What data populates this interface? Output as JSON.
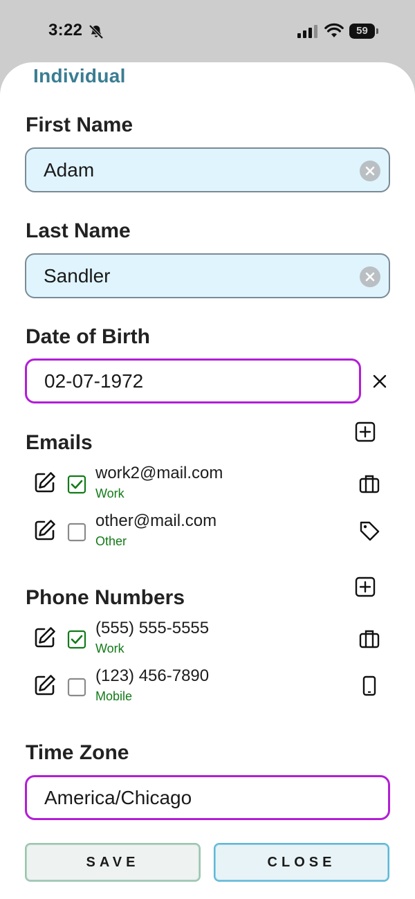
{
  "status_bar": {
    "time": "3:22",
    "battery": "59"
  },
  "sheet": {
    "title": "Individual"
  },
  "form": {
    "first_name": {
      "label": "First Name",
      "value": "Adam"
    },
    "last_name": {
      "label": "Last Name",
      "value": "Sandler"
    },
    "dob": {
      "label": "Date of Birth",
      "value": "02-07-1972"
    },
    "time_zone": {
      "label": "Time Zone",
      "value": "America/Chicago"
    }
  },
  "emails": {
    "label": "Emails",
    "items": [
      {
        "address": "work2@mail.com",
        "type": "Work",
        "checked": true,
        "icon": "briefcase-icon"
      },
      {
        "address": "other@mail.com",
        "type": "Other",
        "checked": false,
        "icon": "tag-icon"
      }
    ]
  },
  "phones": {
    "label": "Phone Numbers",
    "items": [
      {
        "number": "(555) 555-5555",
        "type": "Work",
        "checked": true,
        "icon": "briefcase-icon"
      },
      {
        "number": "(123) 456-7890",
        "type": "Mobile",
        "checked": false,
        "icon": "mobile-phone-icon"
      }
    ]
  },
  "buttons": {
    "save": "SAVE",
    "close": "CLOSE"
  },
  "colors": {
    "accent_purple": "#b21ed6",
    "title_teal": "#3a7d92",
    "type_green": "#127a18",
    "field_fill": "#dff4fd"
  }
}
